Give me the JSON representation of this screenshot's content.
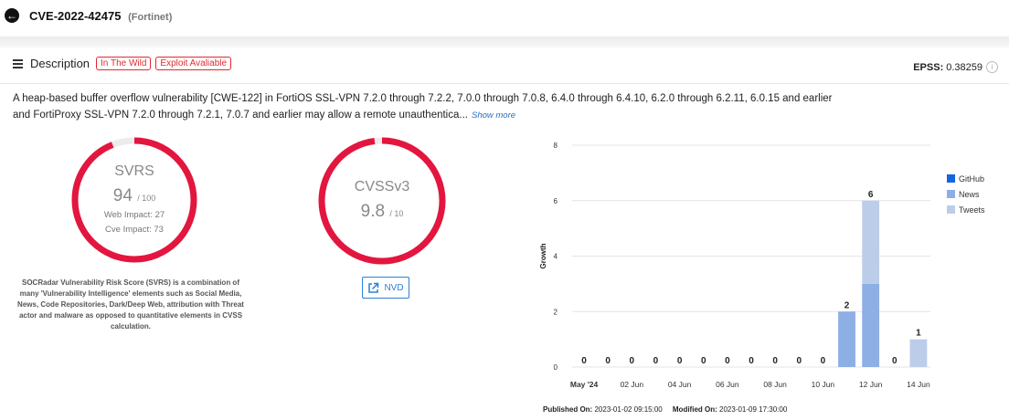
{
  "header": {
    "cve_id": "CVE-2022-42475",
    "vendor": "(Fortinet)"
  },
  "description": {
    "title": "Description",
    "tags": [
      "In The Wild",
      "Exploit Avaliable"
    ],
    "epss_label": "EPSS:",
    "epss_value": "0.38259",
    "text_line1": "A heap-based buffer overflow vulnerability [CWE-122] in FortiOS SSL-VPN 7.2.0 through 7.2.2, 7.0.0 through 7.0.8, 6.4.0 through 6.4.10, 6.2.0 through 6.2.11, 6.0.15 and earlier",
    "text_line2": "and FortiProxy SSL-VPN 7.2.0 through 7.2.1, 7.0.7 and earlier may allow a remote unauthentica...",
    "show_more": "Show more"
  },
  "svrs": {
    "label": "SVRS",
    "score": "94",
    "max": "/ 100",
    "score_fraction": 0.94,
    "web_impact": "Web Impact: 27",
    "cve_impact": "Cve Impact: 73",
    "ring_color": "#e3163f",
    "explanation": "SOCRadar Vulnerability Risk Score (SVRS) is a combination of many 'Vulnerability Intelligence' elements such as Social Media, News, Code Repositories, Dark/Deep Web, attribution with Threat actor and malware as opposed to quantitative elements in CVSS calculation."
  },
  "cvss": {
    "label": "CVSSv3",
    "score": "9.8",
    "max": "/ 10",
    "score_fraction": 0.98,
    "ring_color": "#e3163f",
    "nvd_label": "NVD"
  },
  "chart_data": {
    "type": "bar",
    "stacked": true,
    "ylabel": "Growth",
    "xlabel": "",
    "ylim": [
      0,
      8
    ],
    "yticks": [
      0,
      2,
      4,
      6,
      8
    ],
    "categories": [
      "May '24",
      "",
      "02 Jun",
      "",
      "04 Jun",
      "",
      "06 Jun",
      "",
      "08 Jun",
      "",
      "10 Jun",
      "",
      "12 Jun",
      "",
      "14 Jun"
    ],
    "totals": [
      0,
      0,
      0,
      0,
      0,
      0,
      0,
      0,
      0,
      0,
      0,
      2,
      6,
      0,
      1
    ],
    "series": [
      {
        "name": "GitHub",
        "color": "#1565e0",
        "values": [
          0,
          0,
          0,
          0,
          0,
          0,
          0,
          0,
          0,
          0,
          0,
          0,
          0,
          0,
          0
        ]
      },
      {
        "name": "News",
        "color": "#8eaee6",
        "values": [
          0,
          0,
          0,
          0,
          0,
          0,
          0,
          0,
          0,
          0,
          0,
          2,
          3,
          0,
          0
        ]
      },
      {
        "name": "Tweets",
        "color": "#bccde9",
        "values": [
          0,
          0,
          0,
          0,
          0,
          0,
          0,
          0,
          0,
          0,
          0,
          0,
          3,
          0,
          1
        ]
      }
    ],
    "grid": true,
    "legend_position": "right"
  },
  "footer": {
    "published_label": "Published On:",
    "published_value": "2023-01-02 09:15:00",
    "modified_label": "Modified On:",
    "modified_value": "2023-01-09 17:30:00"
  }
}
